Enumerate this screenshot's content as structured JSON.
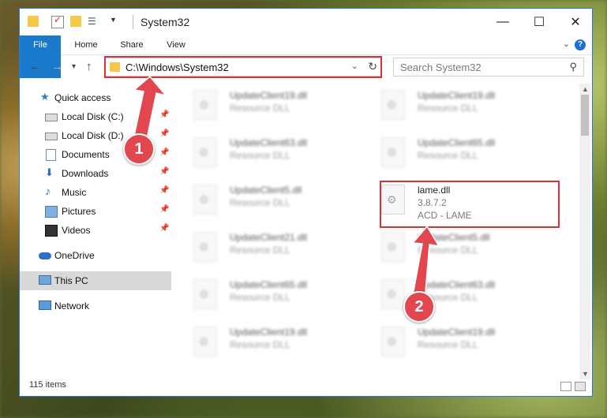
{
  "window": {
    "title": "System32"
  },
  "ribbon": {
    "tabs": [
      "File",
      "Home",
      "Share",
      "View"
    ]
  },
  "address": {
    "path": "C:\\Windows\\System32"
  },
  "search": {
    "placeholder": "Search System32"
  },
  "sidebar": {
    "items": [
      {
        "label": "Quick access",
        "icon": "star-icon"
      },
      {
        "label": "Local Disk (C:)",
        "icon": "drive-icon",
        "pinned": true
      },
      {
        "label": "Local Disk (D:)",
        "icon": "drive-icon",
        "pinned": true
      },
      {
        "label": "Documents",
        "icon": "documents-icon",
        "pinned": true
      },
      {
        "label": "Downloads",
        "icon": "downloads-icon",
        "pinned": true
      },
      {
        "label": "Music",
        "icon": "music-icon",
        "pinned": true
      },
      {
        "label": "Pictures",
        "icon": "pictures-icon",
        "pinned": true
      },
      {
        "label": "Videos",
        "icon": "videos-icon",
        "pinned": true
      },
      {
        "label": "OneDrive",
        "icon": "onedrive-icon"
      },
      {
        "label": "This PC",
        "icon": "pc-icon",
        "selected": true
      },
      {
        "label": "Network",
        "icon": "network-icon"
      }
    ]
  },
  "files": [
    {
      "name": "UpdateClient19.dll",
      "desc": "Resource DLL"
    },
    {
      "name": "UpdateClient19.dll",
      "desc": "Resource DLL"
    },
    {
      "name": "UpdateClient63.dll",
      "desc": "Resource DLL"
    },
    {
      "name": "UpdateClient65.dll",
      "desc": "Resource DLL"
    },
    {
      "name": "UpdateClient5.dll",
      "desc": "Resource DLL"
    },
    {
      "name": "lame.dll",
      "version": "3.8.7.2",
      "desc": "ACD - LAME",
      "highlighted": true
    },
    {
      "name": "UpdateClient21.dll",
      "desc": "Resource DLL"
    },
    {
      "name": "UpdateClient5.dll",
      "desc": "Resource DLL"
    },
    {
      "name": "UpdateClient65.dll",
      "desc": "Resource DLL"
    },
    {
      "name": "UpdateClient63.dll",
      "desc": "Resource DLL"
    },
    {
      "name": "UpdateClient19.dll",
      "desc": "Resource DLL"
    },
    {
      "name": "UpdateClient19.dll",
      "desc": "Resource DLL"
    }
  ],
  "status": {
    "count": "115 items"
  },
  "annotations": {
    "step1": "1",
    "step2": "2"
  },
  "colors": {
    "accent": "#1979ca",
    "highlight": "#d9303a",
    "badge": "#e2474f"
  }
}
